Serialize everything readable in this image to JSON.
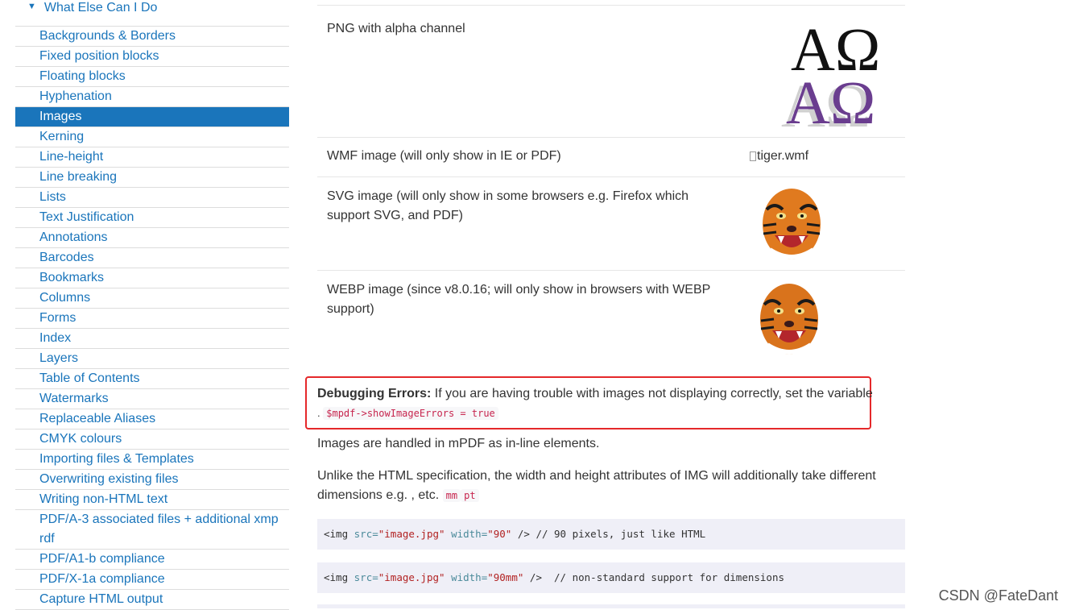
{
  "sidebar": {
    "section_title": "What Else Can I Do",
    "items": [
      {
        "label": "Backgrounds & Borders"
      },
      {
        "label": "Fixed position blocks"
      },
      {
        "label": "Floating blocks"
      },
      {
        "label": "Hyphenation"
      },
      {
        "label": "Images",
        "active": true
      },
      {
        "label": "Kerning"
      },
      {
        "label": "Line-height"
      },
      {
        "label": "Line breaking"
      },
      {
        "label": "Lists"
      },
      {
        "label": "Text Justification"
      },
      {
        "label": "Annotations"
      },
      {
        "label": "Barcodes"
      },
      {
        "label": "Bookmarks"
      },
      {
        "label": "Columns"
      },
      {
        "label": "Forms"
      },
      {
        "label": "Index"
      },
      {
        "label": "Layers"
      },
      {
        "label": "Table of Contents"
      },
      {
        "label": "Watermarks"
      },
      {
        "label": "Replaceable Aliases"
      },
      {
        "label": "CMYK colours"
      },
      {
        "label": "Importing files & Templates"
      },
      {
        "label": "Overwriting existing files"
      },
      {
        "label": "Writing non-HTML text"
      },
      {
        "label": "PDF/A-3 associated files + additional xmp rdf"
      },
      {
        "label": "PDF/A1-b compliance"
      },
      {
        "label": "PDF/X-1a compliance"
      },
      {
        "label": "Capture HTML output"
      }
    ]
  },
  "table": {
    "rows": [
      {
        "desc": "PNG with alpha channel",
        "image": "omega-logo"
      },
      {
        "desc": "WMF image (will only show in IE or PDF)",
        "image_alt": "tiger.wmf"
      },
      {
        "desc": "SVG image (will only show in some browsers e.g. Firefox which support SVG, and PDF)",
        "image": "tiger"
      },
      {
        "desc": "WEBP image (since v8.0.16; will only show in browsers with WEBP support)",
        "image": "tiger"
      }
    ],
    "omega_glyphs": "ΑΩ"
  },
  "callout": {
    "bold": "Debugging Errors:",
    "text": " If you are having trouble with images not displaying correctly, set the variable",
    "prefix": ".",
    "code": "$mpdf->showImageErrors = true"
  },
  "paragraphs": {
    "p1": "Images are handled in mPDF as in-line elements.",
    "p2_line1": "Unlike the HTML specification, the width and height attributes of IMG will additionally take different",
    "p2_line2": "dimensions e.g. , etc.",
    "p2_code1": "mm",
    "p2_code2": "pt"
  },
  "code_blocks": [
    {
      "tag_open": "<img ",
      "attr1": "src=",
      "val1": "\"image.jpg\"",
      "attr2": " width=",
      "val2": "\"90\"",
      "tag_close": " />",
      "comment": " // 90 pixels, just like HTML"
    },
    {
      "tag_open": "<img ",
      "attr1": "src=",
      "val1": "\"image.jpg\"",
      "attr2": " width=",
      "val2": "\"90mm\"",
      "tag_close": " />",
      "comment": "  // non-standard support for dimensions"
    }
  ],
  "watermark": "CSDN @FateDant",
  "colors": {
    "link": "#1a75bb",
    "active_bg": "#1a75bb",
    "callout_border": "#e5282a",
    "code_red": "#c7254e"
  }
}
